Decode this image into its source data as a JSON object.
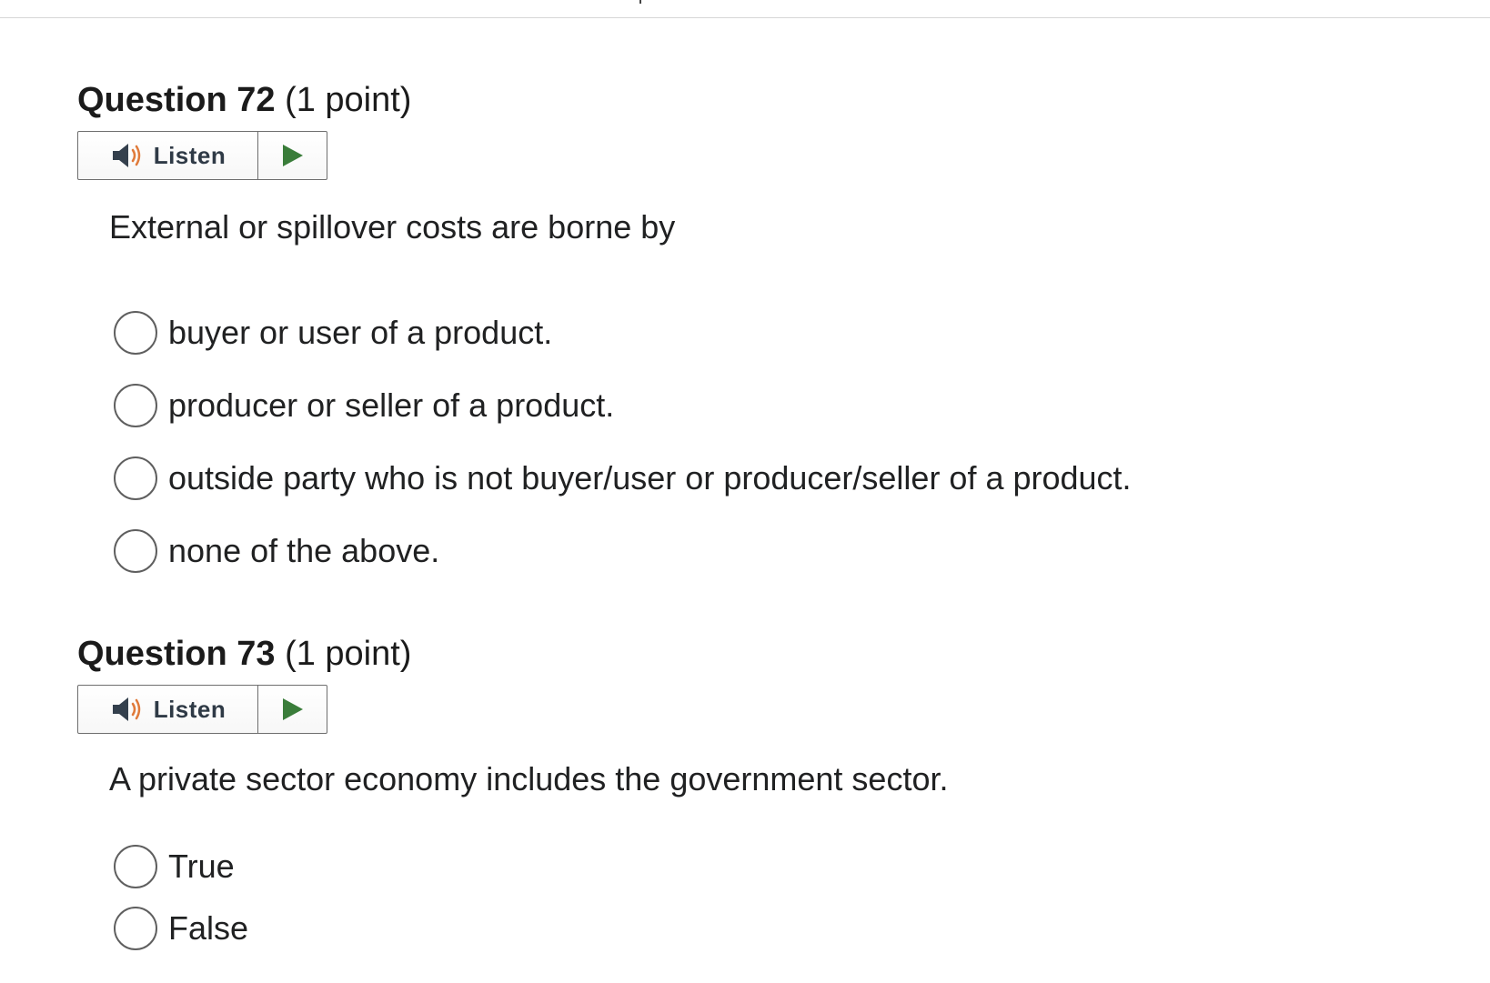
{
  "questions": [
    {
      "label": "Question 72",
      "points": "(1 point)",
      "listen_label": "Listen",
      "prompt": "External or spillover costs are borne by",
      "options": [
        "buyer or user of a product.",
        "producer or seller of a product.",
        "outside party who is not buyer/user or producer/seller of a product.",
        "none of the above."
      ]
    },
    {
      "label": "Question 73",
      "points": "(1 point)",
      "listen_label": "Listen",
      "prompt": "A private sector economy includes the government sector.",
      "options": [
        "True",
        "False"
      ]
    }
  ],
  "colors": {
    "play_icon": "#3a7d3a",
    "speaker_icon": "#34404d",
    "speaker_waves": "#e07a3a",
    "radio_border": "#5f5f5f"
  },
  "icons": {
    "speaker": "speaker-icon",
    "play": "play-icon"
  }
}
